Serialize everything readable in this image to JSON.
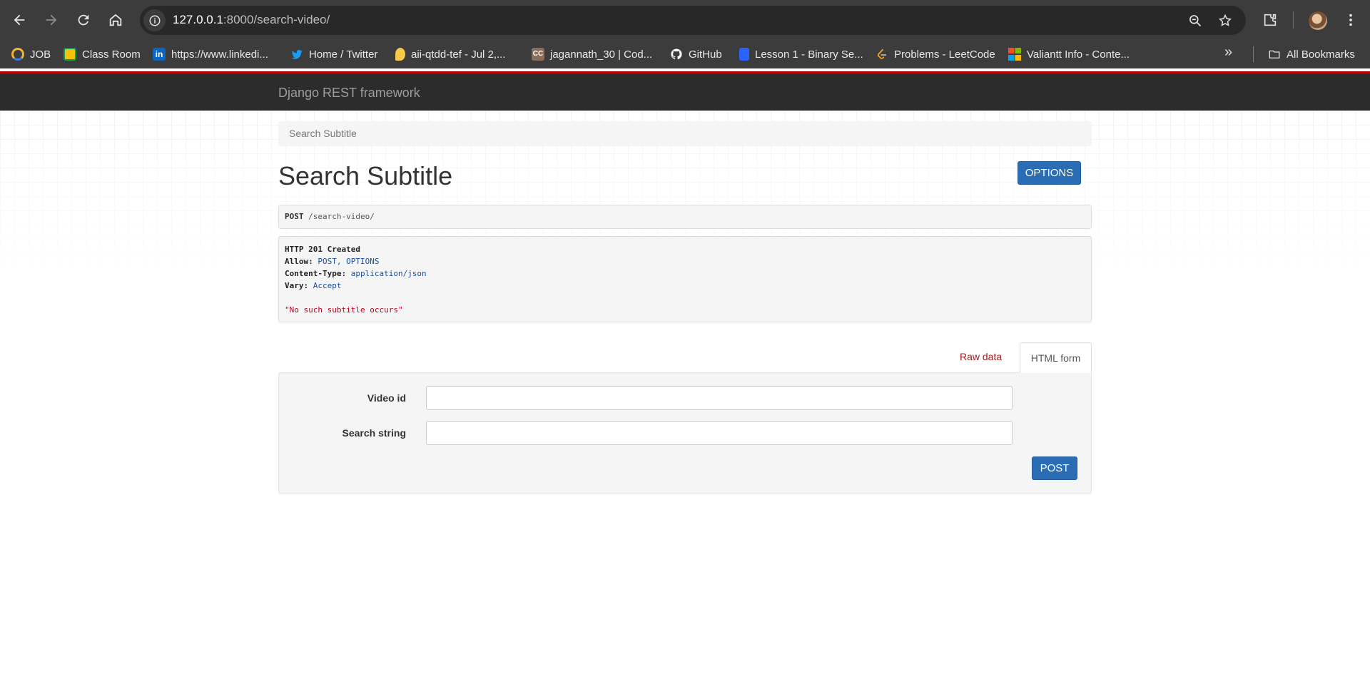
{
  "browser": {
    "url_host": "127.0.0.1",
    "url_rest": ":8000/search-video/",
    "bookmarks": [
      {
        "label": "JOB",
        "icon": "headset-icon",
        "color": "#f2b233"
      },
      {
        "label": "Class Room",
        "icon": "classroom-icon",
        "color": "#f4c20d"
      },
      {
        "label": "https://www.linkedi...",
        "icon": "linkedin-icon",
        "color": "#0a66c2"
      },
      {
        "label": "Home / Twitter",
        "icon": "twitter-icon",
        "color": "#1d9bf0"
      },
      {
        "label": "aii-qtdd-tef - Jul 2,...",
        "icon": "meet-icon",
        "color": "#f7c948"
      },
      {
        "label": "jagannath_30 | Cod...",
        "icon": "codechef-icon",
        "color": "#8b6e5a"
      },
      {
        "label": "GitHub",
        "icon": "github-icon",
        "color": "#ffffff"
      },
      {
        "label": "Lesson 1 - Binary Se...",
        "icon": "codility-icon",
        "color": "#2962ff"
      },
      {
        "label": "Problems - LeetCode",
        "icon": "leetcode-icon",
        "color": "#ffa116"
      },
      {
        "label": "Valiantt Info - Conte...",
        "icon": "microsoft-icon",
        "color": "#f25022"
      }
    ],
    "all_bookmarks_label": "All Bookmarks",
    "accent_red": "#b30000"
  },
  "navbar": {
    "brand": "Django REST framework"
  },
  "breadcrumb": {
    "current": "Search Subtitle"
  },
  "page": {
    "title": "Search Subtitle",
    "options_button": "OPTIONS"
  },
  "request": {
    "method": "POST",
    "path": "/search-video/"
  },
  "response": {
    "status": "HTTP 201 Created",
    "headers": [
      {
        "key": "Allow:",
        "value": "POST, OPTIONS"
      },
      {
        "key": "Content-Type:",
        "value": "application/json"
      },
      {
        "key": "Vary:",
        "value": "Accept"
      }
    ],
    "body": "\"No such subtitle occurs\""
  },
  "form": {
    "tabs": {
      "raw": "Raw data",
      "html": "HTML form"
    },
    "fields": [
      {
        "label": "Video id",
        "value": ""
      },
      {
        "label": "Search string",
        "value": ""
      }
    ],
    "submit": "POST",
    "primary_color": "#2a6db5"
  }
}
